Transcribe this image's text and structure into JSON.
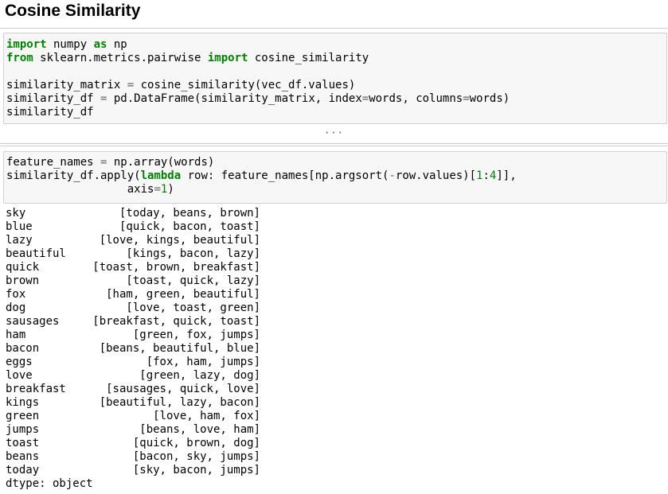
{
  "heading": "Cosine Similarity",
  "cell1": {
    "line1": {
      "kw1": "import",
      "t1": " numpy ",
      "kw2": "as",
      "t2": " np"
    },
    "line2": {
      "kw1": "from",
      "t1": " sklearn.metrics.pairwise ",
      "kw2": "import",
      "t2": " cosine_similarity"
    },
    "line4": {
      "a": "similarity_matrix ",
      "eq": "=",
      "b": " cosine_similarity(vec_df.values)"
    },
    "line5": {
      "a": "similarity_df ",
      "eq": "=",
      "b": " pd.DataFrame(similarity_matrix, index",
      "eq2": "=",
      "c": "words, columns",
      "eq3": "=",
      "d": "words)"
    },
    "line6": "similarity_df"
  },
  "ellipsis": "···",
  "cell2": {
    "line1": {
      "a": "feature_names ",
      "eq": "=",
      "b": " np.array(words)"
    },
    "line2": {
      "a": "similarity_df.apply(",
      "kw": "lambda",
      "b": " row: feature_names[np.argsort(",
      "minus": "-",
      "c": "row.values)[",
      "n1": "1",
      "colon": ":",
      "n2": "4",
      "d": "]],"
    },
    "line3": {
      "indent": "                  axis",
      "eq": "=",
      "n": "1",
      "e": ")"
    }
  },
  "output": {
    "rows": [
      {
        "word": "sky",
        "value": "[today, beans, brown]"
      },
      {
        "word": "blue",
        "value": "[quick, bacon, toast]"
      },
      {
        "word": "lazy",
        "value": "[love, kings, beautiful]"
      },
      {
        "word": "beautiful",
        "value": "[kings, bacon, lazy]"
      },
      {
        "word": "quick",
        "value": "[toast, brown, breakfast]"
      },
      {
        "word": "brown",
        "value": "[toast, quick, lazy]"
      },
      {
        "word": "fox",
        "value": "[ham, green, beautiful]"
      },
      {
        "word": "dog",
        "value": "[love, toast, green]"
      },
      {
        "word": "sausages",
        "value": "[breakfast, quick, toast]"
      },
      {
        "word": "ham",
        "value": "[green, fox, jumps]"
      },
      {
        "word": "bacon",
        "value": "[beans, beautiful, blue]"
      },
      {
        "word": "eggs",
        "value": "[fox, ham, jumps]"
      },
      {
        "word": "love",
        "value": "[green, lazy, dog]"
      },
      {
        "word": "breakfast",
        "value": "[sausages, quick, love]"
      },
      {
        "word": "kings",
        "value": "[beautiful, lazy, bacon]"
      },
      {
        "word": "green",
        "value": "[love, ham, fox]"
      },
      {
        "word": "jumps",
        "value": "[beans, love, ham]"
      },
      {
        "word": "toast",
        "value": "[quick, brown, dog]"
      },
      {
        "word": "beans",
        "value": "[bacon, sky, jumps]"
      },
      {
        "word": "today",
        "value": "[sky, bacon, jumps]"
      }
    ],
    "dtype": "dtype: object"
  }
}
